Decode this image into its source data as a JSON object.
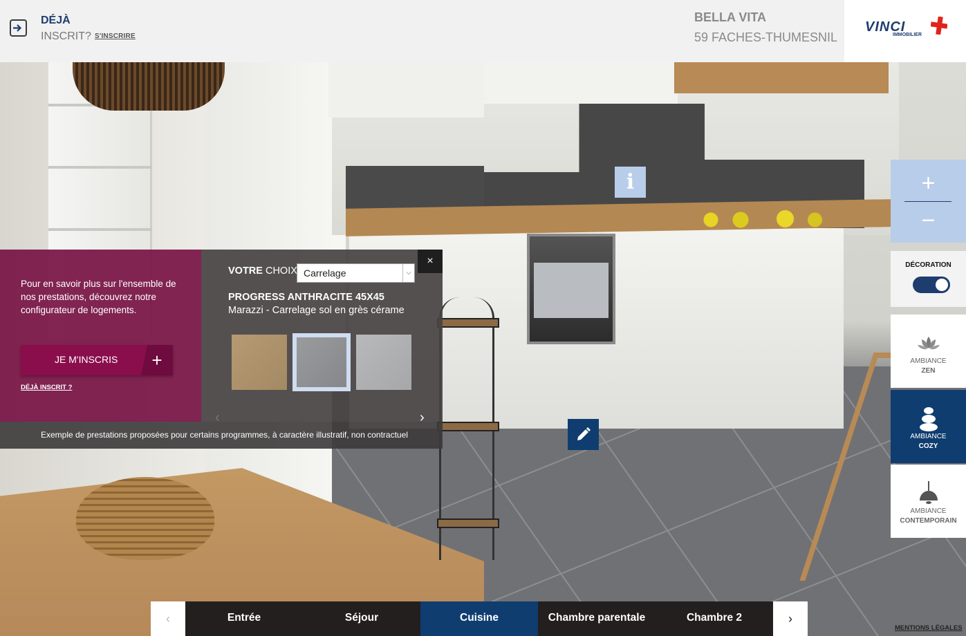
{
  "header": {
    "login_title": "DÉJÀ",
    "login_subtitle": "INSCRIT?",
    "register_link": "S'INSCRIRE",
    "program_name": "BELLA VITA",
    "program_city": "59 FACHES-THUMESNIL"
  },
  "logo": {
    "brand": "VINCI",
    "sub": "IMMOBILIER"
  },
  "promo": {
    "text": "Pour en savoir plus sur l'ensemble de nos prestations, découvrez notre configurateur de logements.",
    "button_label": "JE M'INSCRIS",
    "button_icon": "+",
    "link": "DÉJÀ INSCRIT ?"
  },
  "configurator": {
    "label_bold": "VOTRE",
    "label_rest": " CHOIX",
    "select_value": "Carrelage",
    "close_icon": "×",
    "product_name": "PROGRESS ANTHRACITE 45X45",
    "product_desc": "Marazzi - Carrelage sol en grès cérame",
    "swatches": [
      {
        "name": "beige",
        "color": "#ac9169"
      },
      {
        "name": "anthracite",
        "color": "#909193",
        "selected": true
      },
      {
        "name": "gris-clair",
        "color": "#afb0b2"
      }
    ],
    "prev_icon": "‹",
    "next_icon": "›"
  },
  "disclaimer": "Exemple de prestations proposées pour certains programmes, à caractère illustratif, non contractuel",
  "markers": {
    "info_icon": "i"
  },
  "toolbar": {
    "zoom_in": "+",
    "zoom_out": "−",
    "decoration_label": "DÉCORATION",
    "decoration_on": true,
    "ambiances": [
      {
        "title": "AMBIANCE",
        "name": "ZEN",
        "icon": "lotus-icon"
      },
      {
        "title": "AMBIANCE",
        "name": "COZY",
        "icon": "stones-icon",
        "active": true
      },
      {
        "title": "AMBIANCE",
        "name": "CONTEMPORAIN",
        "icon": "pendant-lamp-icon"
      }
    ]
  },
  "rooms": {
    "prev_icon": "‹",
    "next_icon": "›",
    "tabs": [
      {
        "label": "Entrée"
      },
      {
        "label": "Séjour"
      },
      {
        "label": "Cuisine",
        "active": true
      },
      {
        "label": "Chambre parentale"
      },
      {
        "label": "Chambre 2"
      }
    ]
  },
  "footer": {
    "mentions": "MENTIONS LÉGALES"
  },
  "colors": {
    "brand_blue": "#0f3d70",
    "accent_light_blue": "#b8cde9",
    "promo_magenta": "#8a0e4c",
    "vinci_red": "#e2231a"
  }
}
